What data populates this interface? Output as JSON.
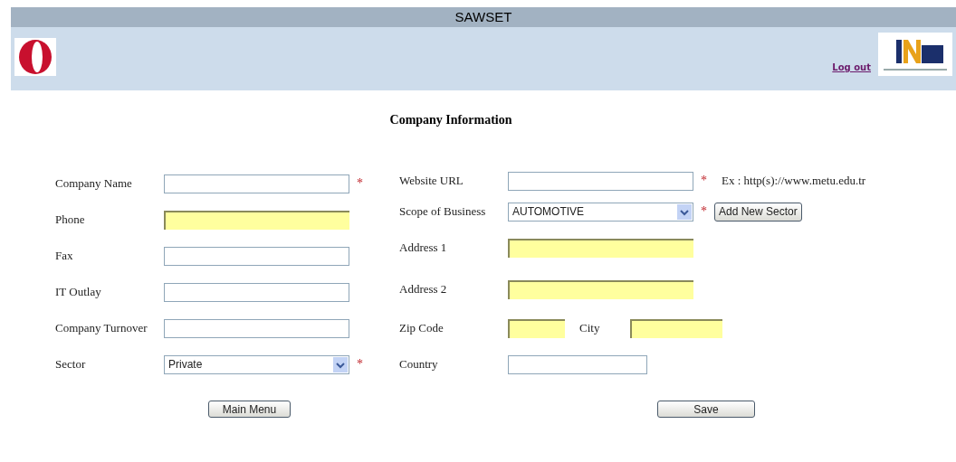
{
  "header": {
    "title": "SAWSET",
    "logout": "Log out"
  },
  "form": {
    "title": "Company Information",
    "left_rows": [
      {
        "cells": [
          {
            "kind": "label",
            "text": "Company Name"
          },
          {
            "kind": "text",
            "required_mark": "*",
            "highlighted": false
          }
        ]
      },
      {
        "cells": [
          {
            "kind": "label",
            "text": "Phone"
          },
          {
            "kind": "text",
            "highlighted": true
          }
        ]
      },
      {
        "cells": [
          {
            "kind": "label",
            "text": "Fax"
          },
          {
            "kind": "text",
            "highlighted": false
          }
        ]
      },
      {
        "cells": [
          {
            "kind": "label",
            "text": "IT Outlay"
          },
          {
            "kind": "text",
            "highlighted": false
          }
        ]
      },
      {
        "cells": [
          {
            "kind": "label",
            "text": "Company Turnover"
          },
          {
            "kind": "text",
            "highlighted": false
          }
        ]
      },
      {
        "cells": [
          {
            "kind": "label",
            "text": "Sector"
          },
          {
            "kind": "select",
            "value": "Private",
            "required_mark": "*",
            "highlighted": false
          }
        ]
      }
    ],
    "right_rows": [
      {
        "cells": [
          {
            "kind": "label",
            "text": "Website URL"
          },
          {
            "kind": "text",
            "required_mark": "*",
            "highlighted": false
          },
          {
            "kind": "note",
            "text": "Ex : http(s)://www.metu.edu.tr"
          }
        ]
      },
      {
        "cells": [
          {
            "kind": "label",
            "text": "Scope of Business"
          },
          {
            "kind": "select",
            "value": "AUTOMOTIVE",
            "required_mark": "*",
            "highlighted": false
          },
          {
            "kind": "button",
            "text": "Add New Sector"
          }
        ]
      },
      {
        "cells": [
          {
            "kind": "label",
            "text": "Address 1"
          },
          {
            "kind": "text",
            "highlighted": true
          }
        ]
      },
      {
        "cells": [
          {
            "kind": "label",
            "text": "Address 2"
          },
          {
            "kind": "text",
            "highlighted": true
          }
        ]
      },
      {
        "cells": [
          {
            "kind": "label",
            "text": "Zip Code"
          },
          {
            "kind": "text",
            "highlighted": true
          },
          {
            "kind": "label",
            "text": "City"
          },
          {
            "kind": "text",
            "highlighted": true
          }
        ]
      },
      {
        "cells": [
          {
            "kind": "label",
            "text": "Country"
          },
          {
            "kind": "text",
            "highlighted": false
          }
        ]
      }
    ],
    "left_button": "Main Menu",
    "right_button": "Save"
  }
}
